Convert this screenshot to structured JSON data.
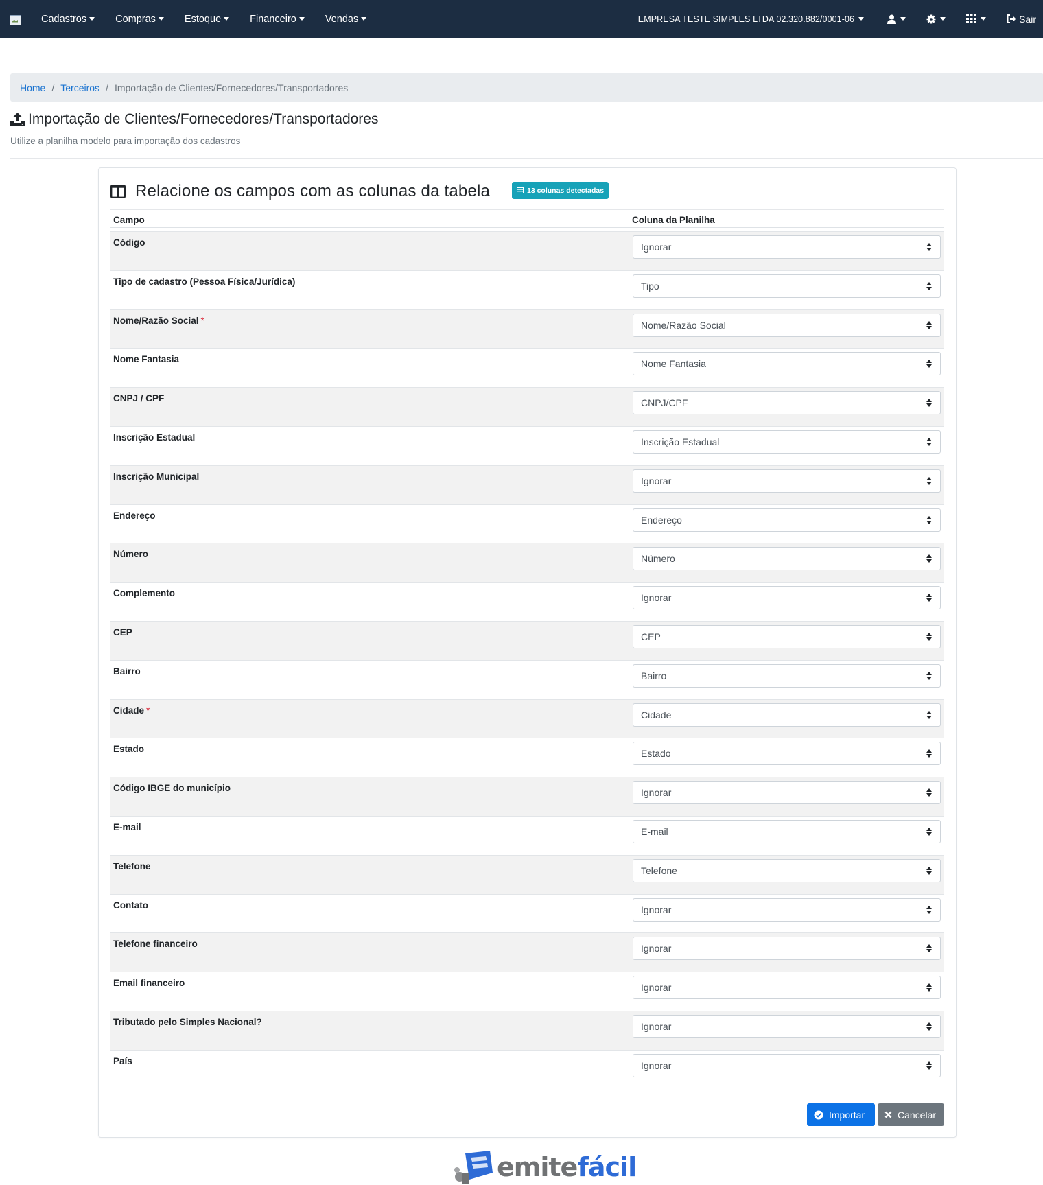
{
  "nav": {
    "menu": [
      "Cadastros",
      "Compras",
      "Estoque",
      "Financeiro",
      "Vendas"
    ],
    "company": "EMPRESA TESTE SIMPLES LTDA 02.320.882/0001-06",
    "logout": "Sair",
    "icons": [
      "user-icon",
      "gear-icon",
      "apps-grid-icon",
      "sign-out-icon"
    ]
  },
  "breadcrumb": {
    "home": "Home",
    "parent": "Terceiros",
    "current": "Importação de Clientes/Fornecedores/Transportadores",
    "separator": "/"
  },
  "page": {
    "title": "Importação de Clientes/Fornecedores/Transportadores",
    "subtitle": "Utilize a planilha modelo para importação dos cadastros"
  },
  "card": {
    "title": "Relacione os campos com as colunas da tabela",
    "badge": "13 colunas detectadas",
    "col_campo": "Campo",
    "col_coluna": "Coluna da Planilha",
    "rows": [
      {
        "label": "Código",
        "required": false,
        "value": "Ignorar"
      },
      {
        "label": "Tipo de cadastro (Pessoa Física/Jurídica)",
        "required": false,
        "value": "Tipo"
      },
      {
        "label": "Nome/Razão Social",
        "required": true,
        "value": "Nome/Razão Social"
      },
      {
        "label": "Nome Fantasia",
        "required": false,
        "value": "Nome Fantasia"
      },
      {
        "label": "CNPJ / CPF",
        "required": false,
        "value": "CNPJ/CPF"
      },
      {
        "label": "Inscrição Estadual",
        "required": false,
        "value": "Inscrição Estadual"
      },
      {
        "label": "Inscrição Municipal",
        "required": false,
        "value": "Ignorar"
      },
      {
        "label": "Endereço",
        "required": false,
        "value": "Endereço"
      },
      {
        "label": "Número",
        "required": false,
        "value": "Número"
      },
      {
        "label": "Complemento",
        "required": false,
        "value": "Ignorar"
      },
      {
        "label": "CEP",
        "required": false,
        "value": "CEP"
      },
      {
        "label": "Bairro",
        "required": false,
        "value": "Bairro"
      },
      {
        "label": "Cidade",
        "required": true,
        "value": "Cidade"
      },
      {
        "label": "Estado",
        "required": false,
        "value": "Estado"
      },
      {
        "label": "Código IBGE do município",
        "required": false,
        "value": "Ignorar"
      },
      {
        "label": "E-mail",
        "required": false,
        "value": "E-mail"
      },
      {
        "label": "Telefone",
        "required": false,
        "value": "Telefone"
      },
      {
        "label": "Contato",
        "required": false,
        "value": "Ignorar"
      },
      {
        "label": "Telefone financeiro",
        "required": false,
        "value": "Ignorar"
      },
      {
        "label": "Email financeiro",
        "required": false,
        "value": "Ignorar"
      },
      {
        "label": "Tributado pelo Simples Nacional?",
        "required": false,
        "value": "Ignorar"
      },
      {
        "label": "País",
        "required": false,
        "value": "Ignorar"
      }
    ],
    "import_label": "Importar",
    "cancel_label": "Cancelar"
  },
  "footer": {
    "logo_text_gray": "emite",
    "logo_text_blue": "fácil"
  },
  "colors": {
    "navbar": "#1c2d42",
    "primary": "#0c72e6",
    "secondary": "#6c757d",
    "badge": "#17a2b8",
    "required": "#dc3545",
    "link": "#1a73d0"
  }
}
